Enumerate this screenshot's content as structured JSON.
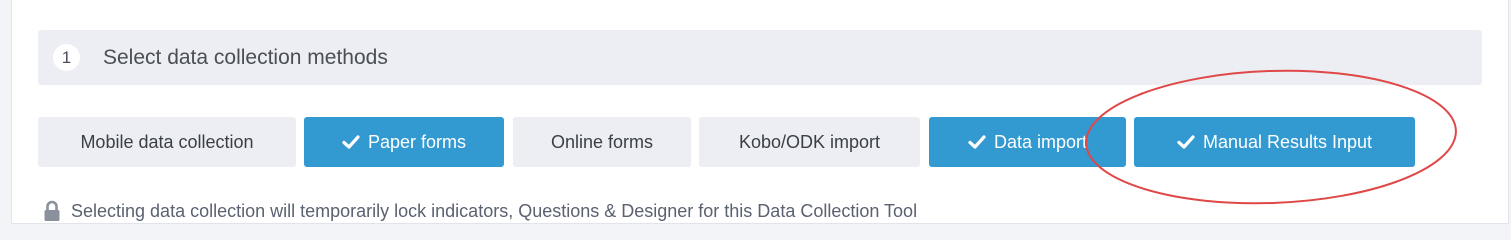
{
  "step": {
    "number": "1",
    "title": "Select data collection methods"
  },
  "methods": [
    {
      "label": "Mobile data collection",
      "selected": false
    },
    {
      "label": "Paper forms",
      "selected": true
    },
    {
      "label": "Online forms",
      "selected": false
    },
    {
      "label": "Kobo/ODK import",
      "selected": false
    },
    {
      "label": "Data import",
      "selected": true
    },
    {
      "label": "Manual Results Input",
      "selected": true
    }
  ],
  "lock_note": "Selecting data collection will temporarily lock indicators, Questions & Designer for this Data Collection Tool",
  "colors": {
    "selected_bg": "#3399d1",
    "unselected_bg": "#eceef3",
    "annotation_ellipse": "#e04848"
  },
  "icons": {
    "check": "check-icon",
    "lock": "lock-icon"
  }
}
